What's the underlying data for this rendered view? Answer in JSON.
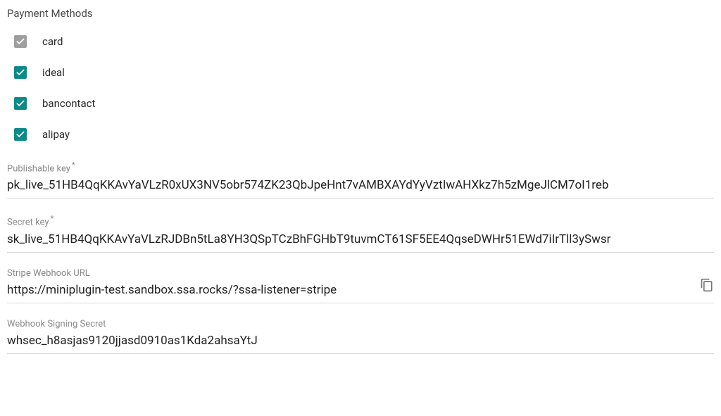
{
  "section_title": "Payment Methods",
  "payment_methods": [
    {
      "id": "card",
      "label": "card",
      "checked": true,
      "disabled": true
    },
    {
      "id": "ideal",
      "label": "ideal",
      "checked": true,
      "disabled": false
    },
    {
      "id": "bancontact",
      "label": "bancontact",
      "checked": true,
      "disabled": false
    },
    {
      "id": "alipay",
      "label": "alipay",
      "checked": true,
      "disabled": false
    }
  ],
  "fields": {
    "publishable_key": {
      "label": "Publishable key",
      "required": true,
      "value": "pk_live_51HB4QqKKAvYaVLzR0xUX3NV5obr574ZK23QbJpeHnt7vAMBXAYdYyVztIwAHXkz7h5zMgeJlCM7oI1reb"
    },
    "secret_key": {
      "label": "Secret key",
      "required": true,
      "value": "sk_live_51HB4QqKKAvYaVLzRJDBn5tLa8YH3QSpTCzBhFGHbT9tuvmCT61SF5EE4QqseDWHr51EWd7iIrTll3ySwsr"
    },
    "webhook_url": {
      "label": "Stripe Webhook URL",
      "required": false,
      "value": "https://miniplugin-test.sandbox.ssa.rocks/?ssa-listener=stripe",
      "copyable": true
    },
    "webhook_signing_secret": {
      "label": "Webhook Signing Secret",
      "required": false,
      "value": "whsec_h8asjas9120jjasd0910as1Kda2ahsaYtJ"
    }
  }
}
